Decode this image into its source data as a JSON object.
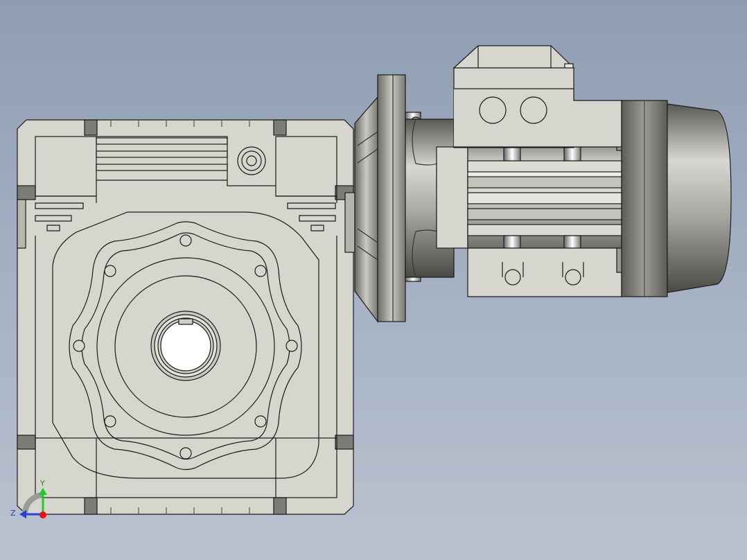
{
  "viewport": {
    "background_top": "#8e9db2",
    "background_bottom": "#b9c2d0",
    "model_name": "worm-gear-motor-assembly",
    "view": "front"
  },
  "model": {
    "body_color": "#d6d6cf",
    "shadow_color": "#808080",
    "edge_color": "#1a1a1a",
    "parts": [
      "gearbox-housing",
      "hollow-output-shaft",
      "motor-flange",
      "motor-body",
      "terminal-box",
      "motor-fan-cover"
    ]
  },
  "triad": {
    "y_label": "Y",
    "z_label": "Z",
    "y_color": "#22cc22",
    "z_color": "#2244dd",
    "x_color": "#ee1111"
  }
}
